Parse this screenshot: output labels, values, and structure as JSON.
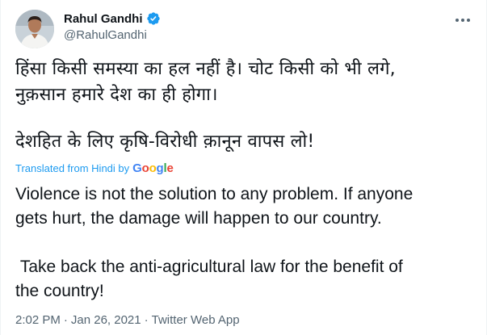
{
  "author": {
    "display_name": "Rahul Gandhi",
    "handle": "@RahulGandhi",
    "verified": true
  },
  "icons": {
    "verified": "verified-badge-icon",
    "more": "more-horizontal-icon",
    "avatar": "profile-photo"
  },
  "tweet": {
    "hindi_line1": "हिंसा किसी समस्या का हल नहीं है। चोट किसी को भी लगे,",
    "hindi_line2": "नुक़सान हमारे देश का ही होगा।",
    "hindi_line3": "देशहित के लिए कृषि-विरोधी क़ानून वापस लो!",
    "translated_label": "Translated from Hindi by",
    "translator_brand": "Google",
    "english_line1": "Violence is not the solution to any problem. If anyone",
    "english_line2": "gets hurt, the damage will happen to our country.",
    "english_line3": " Take back the anti-agricultural law for the benefit of",
    "english_line4": "the country!"
  },
  "meta": {
    "time": "2:02 PM",
    "separator1": "·",
    "date": "Jan 26, 2021",
    "separator2": "·",
    "source": "Twitter Web App"
  },
  "colors": {
    "text": "#0f1419",
    "secondary": "#536471",
    "link": "#1d9bf0",
    "google_blue": "#4285f4",
    "google_red": "#ea4335",
    "google_yellow": "#fbbc05",
    "google_green": "#34a853"
  }
}
